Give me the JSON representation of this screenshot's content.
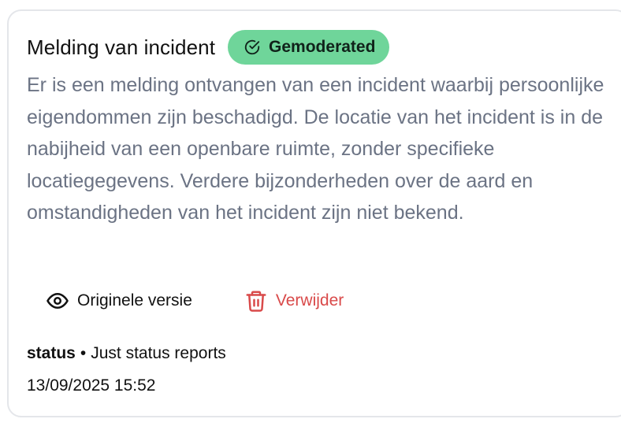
{
  "card": {
    "title": "Melding van incident",
    "badge": {
      "label": "Gemoderated",
      "icon": "check-circle-icon",
      "color": "#6fd59a"
    },
    "description": "Er is een melding ontvangen van een incident waarbij persoonlijke eigendommen zijn beschadigd. De locatie van het incident is in de nabijheid van een openbare ruimte, zonder specifieke locatiegegevens. Verdere bijzonderheden over de aard en omstandigheden van het incident zijn niet bekend.",
    "actions": {
      "original": {
        "label": "Originele versie",
        "icon": "eye-icon"
      },
      "delete": {
        "label": "Verwijder",
        "icon": "trash-icon",
        "color": "#d94a4a"
      }
    },
    "meta": {
      "type": "status",
      "separator": "•",
      "category": "Just status reports"
    },
    "timestamp": "13/09/2025 15:52"
  }
}
